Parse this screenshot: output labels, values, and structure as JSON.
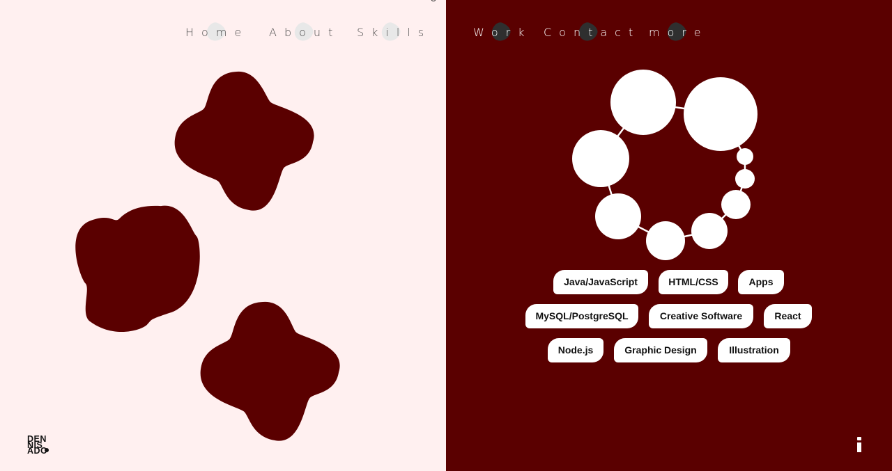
{
  "nav": {
    "left": [
      "Home",
      "About",
      "Skills"
    ],
    "right": [
      "Work",
      "Contact",
      "more"
    ]
  },
  "skills": [
    "Java/JavaScript",
    "HTML/CSS",
    "Apps",
    "MySQL/PostgreSQL",
    "Creative Software",
    "React",
    "Node.js",
    "Graphic Design",
    "Illustration"
  ],
  "logo": {
    "lines": [
      "DEN",
      "NIS",
      "ADO"
    ]
  },
  "icons": {
    "info": "info-icon"
  },
  "colors": {
    "left_background": "#fff0f0",
    "right_background": "#5a0000",
    "shape_fill": "#5a0000",
    "bubble_fill": "#ffffff"
  }
}
